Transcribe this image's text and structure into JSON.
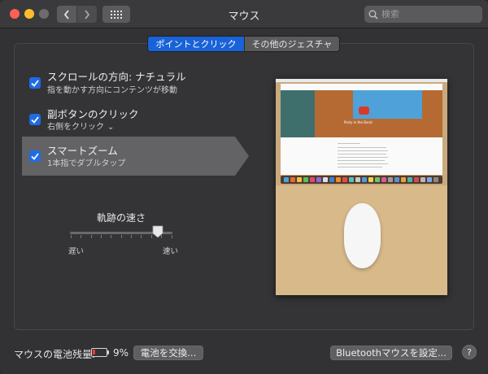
{
  "window": {
    "title": "マウス"
  },
  "search": {
    "placeholder": "検索"
  },
  "tabs": [
    {
      "label": "ポイントとクリック",
      "active": true
    },
    {
      "label": "その他のジェスチャ",
      "active": false
    }
  ],
  "options": [
    {
      "title": "スクロールの方向: ナチュラル",
      "subtitle": "指を動かす方向にコンテンツが移動",
      "checked": true
    },
    {
      "title": "副ボタンのクリック",
      "subtitle": "右側をクリック",
      "checked": true,
      "dropdown": true
    },
    {
      "title": "スマートズーム",
      "subtitle": "1本指でダブルタップ",
      "checked": true,
      "selected": true
    }
  ],
  "tracking": {
    "label": "軌跡の速さ",
    "min_label": "遅い",
    "max_label": "速い",
    "level": 0.86
  },
  "preview": {
    "hero_text": "Party in the Band"
  },
  "battery": {
    "label": "マウスの電池残量:",
    "percent": "9%"
  },
  "buttons": {
    "replace_battery": "電池を交換...",
    "bluetooth_setup": "Bluetoothマウスを設定...",
    "help": "?"
  },
  "colors": {
    "accent": "#1e6be6",
    "battery_low": "#ff3b30"
  }
}
